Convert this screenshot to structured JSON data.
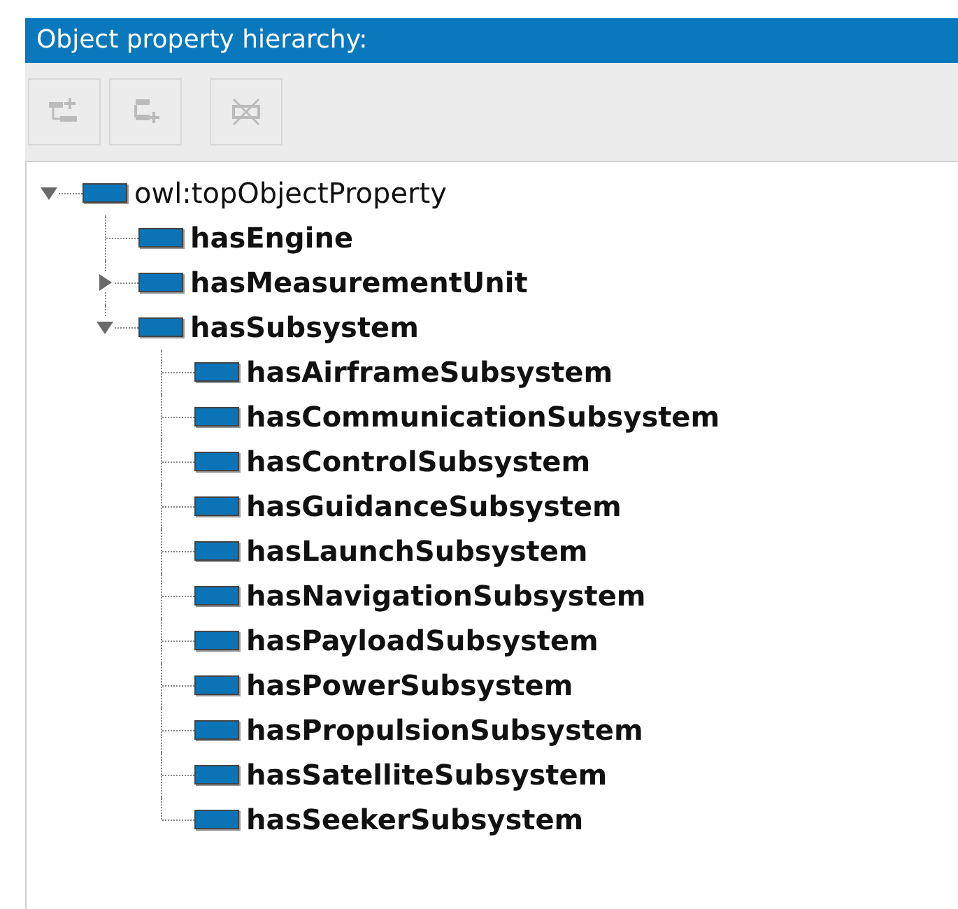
{
  "panel": {
    "title": "Object property hierarchy:"
  },
  "toolbar": [
    {
      "kind": "add-sub",
      "disabled": true
    },
    {
      "kind": "add-sibling",
      "disabled": true
    },
    {
      "kind": "delete",
      "disabled": true
    }
  ],
  "tree": [
    {
      "label": "owl:topObjectProperty",
      "asserted": false,
      "expanded": true,
      "children": [
        {
          "label": "hasEngine",
          "asserted": true
        },
        {
          "label": "hasMeasurementUnit",
          "asserted": true,
          "expanded": false
        },
        {
          "label": "hasSubsystem",
          "asserted": true,
          "expanded": true,
          "children": [
            {
              "label": "hasAirframeSubsystem",
              "asserted": true
            },
            {
              "label": "hasCommunicationSubsystem",
              "asserted": true
            },
            {
              "label": "hasControlSubsystem",
              "asserted": true
            },
            {
              "label": "hasGuidanceSubsystem",
              "asserted": true
            },
            {
              "label": "hasLaunchSubsystem",
              "asserted": true
            },
            {
              "label": "hasNavigationSubsystem",
              "asserted": true
            },
            {
              "label": "hasPayloadSubsystem",
              "asserted": true
            },
            {
              "label": "hasPowerSubsystem",
              "asserted": true
            },
            {
              "label": "hasPropulsionSubsystem",
              "asserted": true
            },
            {
              "label": "hasSatelliteSubsystem",
              "asserted": true
            },
            {
              "label": "hasSeekerSubsystem",
              "asserted": true
            }
          ]
        }
      ]
    }
  ]
}
